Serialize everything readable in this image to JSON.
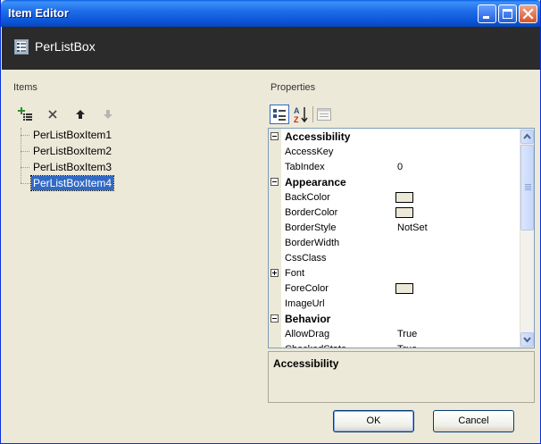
{
  "window": {
    "title": "Item Editor",
    "header_title": "PerListBox",
    "header_icon": "listbox-icon"
  },
  "items_panel": {
    "label": "Items",
    "toolbar": {
      "add_icon": "add-item-icon",
      "delete_icon": "delete-icon",
      "move_up_icon": "arrow-up-icon",
      "move_down_icon": "arrow-down-icon"
    },
    "items": [
      "PerListBoxItem1",
      "PerListBoxItem2",
      "PerListBoxItem3",
      "PerListBoxItem4"
    ],
    "selected_index": 3
  },
  "properties_panel": {
    "label": "Properties",
    "toolbar": {
      "categorized_icon": "categorized-icon",
      "alphabetical_icon": "sort-az-icon",
      "property_pages_icon": "property-pages-icon"
    },
    "rows": [
      {
        "name": "Accessibility",
        "category": true,
        "expanded": true
      },
      {
        "name": "AccessKey",
        "value": ""
      },
      {
        "name": "TabIndex",
        "value": "0"
      },
      {
        "name": "Appearance",
        "category": true,
        "expanded": true
      },
      {
        "name": "BackColor",
        "swatch": true
      },
      {
        "name": "BorderColor",
        "swatch": true
      },
      {
        "name": "BorderStyle",
        "value": "NotSet"
      },
      {
        "name": "BorderWidth",
        "value": ""
      },
      {
        "name": "CssClass",
        "value": ""
      },
      {
        "name": "Font",
        "collapsed": true
      },
      {
        "name": "ForeColor",
        "swatch": true
      },
      {
        "name": "ImageUrl",
        "value": ""
      },
      {
        "name": "Behavior",
        "category": true,
        "expanded": true
      },
      {
        "name": "AllowDrag",
        "value": "True"
      },
      {
        "name": "CheckedState",
        "value": "True"
      }
    ],
    "description_title": "Accessibility"
  },
  "buttons": {
    "ok": "OK",
    "cancel": "Cancel"
  },
  "colors": {
    "titlebar": "#0a55d8",
    "header": "#2b2b2b",
    "selection": "#316ac5",
    "face": "#ece9d8"
  }
}
